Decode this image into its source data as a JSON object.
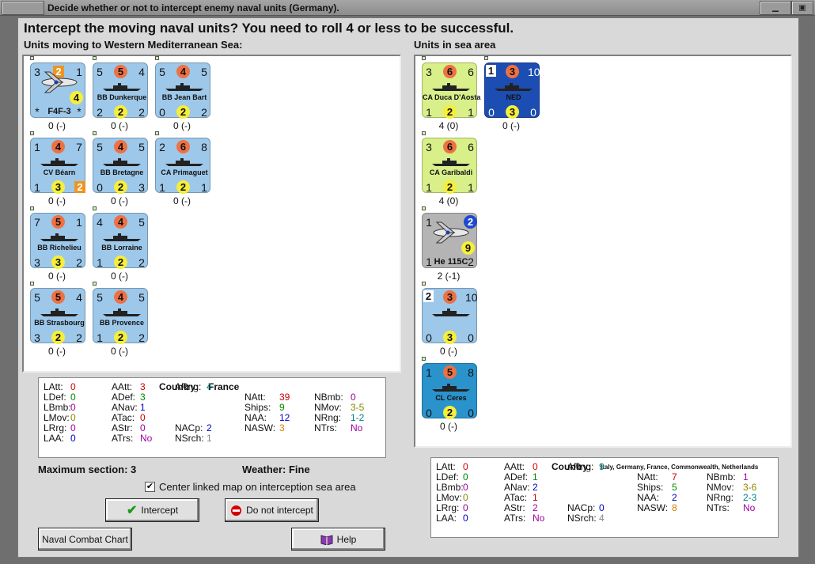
{
  "window": {
    "title": "Decide whether or not to intercept enemy naval units (Germany).",
    "min_glyph": "▁",
    "max_glyph": "▣"
  },
  "heading": "Intercept the moving naval units?  You need to roll 4 or less to be successful.",
  "left_label": "Units moving to Western Mediterranean Sea:",
  "right_label": "Units in sea area",
  "moving_units": [
    {
      "name": "F4F-3",
      "kind": "air",
      "tl": "3",
      "tc": "2",
      "tr": "1",
      "bl": "*",
      "bc": "4",
      "br": "*",
      "value": "0 (-)"
    },
    {
      "name": "BB Dunkerque",
      "tl": "5",
      "tc": "5",
      "tr": "4",
      "bl": "2",
      "bc": "2",
      "br": "2",
      "value": "0 (-)"
    },
    {
      "name": "BB Jean Bart",
      "tl": "5",
      "tc": "4",
      "tr": "5",
      "bl": "0",
      "bc": "2",
      "br": "2",
      "value": "0 (-)"
    },
    {
      "name": "CV Béarn",
      "tl": "1",
      "tc": "4",
      "tr": "7",
      "bl": "1",
      "bc": "3",
      "br": "2",
      "value": "0 (-)"
    },
    {
      "name": "BB Bretagne",
      "tl": "5",
      "tc": "4",
      "tr": "5",
      "bl": "0",
      "bc": "2",
      "br": "3",
      "value": "0 (-)"
    },
    {
      "name": "CA Primaguet",
      "tl": "2",
      "tc": "6",
      "tr": "8",
      "bl": "1",
      "bc": "2",
      "br": "1",
      "value": "0 (-)"
    },
    {
      "name": "BB Richelieu",
      "tl": "7",
      "tc": "5",
      "tr": "1",
      "bl": "3",
      "bc": "3",
      "br": "2",
      "value": "0 (-)"
    },
    {
      "name": "BB Lorraine",
      "tl": "4",
      "tc": "4",
      "tr": "5",
      "bl": "1",
      "bc": "2",
      "br": "2",
      "value": "0 (-)"
    },
    {
      "name": "BB Strasbourg",
      "tl": "5",
      "tc": "5",
      "tr": "4",
      "bl": "3",
      "bc": "2",
      "br": "2",
      "value": "0 (-)"
    },
    {
      "name": "BB Provence",
      "tl": "5",
      "tc": "4",
      "tr": "5",
      "bl": "1",
      "bc": "2",
      "br": "2",
      "value": "0 (-)"
    }
  ],
  "sea_units": [
    {
      "name": "CA Duca D'Aosta",
      "tl": "3",
      "tc": "6",
      "tr": "6",
      "bl": "1",
      "bc": "2",
      "br": "1",
      "value": "4 (0)"
    },
    {
      "name": "NED",
      "tl": "1",
      "tc": "3",
      "tr": "10",
      "bl": "0",
      "bc": "3",
      "br": "0",
      "value": "0 (-)"
    },
    {
      "name": "CA Garibaldi",
      "tl": "3",
      "tc": "6",
      "tr": "6",
      "bl": "1",
      "bc": "2",
      "br": "1",
      "value": "4 (0)"
    },
    {
      "name": "He 115C",
      "tl": "1",
      "tc": "",
      "tr": "2",
      "bl": "1",
      "bc": "9",
      "br": "2",
      "value": "2 (-1)"
    },
    {
      "name": "",
      "tl": "2",
      "tc": "3",
      "tr": "10",
      "bl": "0",
      "bc": "3",
      "br": "0",
      "value": "0 (-)"
    },
    {
      "name": "CL Ceres",
      "tl": "1",
      "tc": "5",
      "tr": "8",
      "bl": "0",
      "bc": "2",
      "br": "0",
      "value": "0 (-)"
    }
  ],
  "left_stats": {
    "country_label": "Country:",
    "country": "France",
    "col1": [
      [
        "LAtt:",
        "0"
      ],
      [
        "LDef:",
        "0"
      ],
      [
        "LBmb:",
        "0"
      ],
      [
        "LMov:",
        "0"
      ],
      [
        "LRrg:",
        "0"
      ],
      [
        "LAA:",
        "0"
      ]
    ],
    "col2": [
      [
        "AAtt:",
        "3"
      ],
      [
        "ADef:",
        "3"
      ],
      [
        "ANav:",
        "1"
      ],
      [
        "ATac:",
        "0"
      ],
      [
        "AStr:",
        "0"
      ],
      [
        "ATrs:",
        "No"
      ]
    ],
    "col3": [
      [
        "ARng:",
        "4"
      ],
      [
        "NACp:",
        "2"
      ],
      [
        "NSrch:",
        "1"
      ]
    ],
    "col4": [
      [
        "NAtt:",
        "39"
      ],
      [
        "Ships:",
        "9"
      ],
      [
        "NAA:",
        "12"
      ],
      [
        "NASW:",
        "3"
      ]
    ],
    "col5": [
      [
        "NBmb:",
        "0"
      ],
      [
        "NMov:",
        "3-5"
      ],
      [
        "NRng:",
        "1-2"
      ],
      [
        "NTrs:",
        "No"
      ]
    ]
  },
  "right_stats": {
    "country_label": "Country:",
    "country": "Italy, Germany, France, Commonwealth, Netherlands",
    "col1": [
      [
        "LAtt:",
        "0"
      ],
      [
        "LDef:",
        "0"
      ],
      [
        "LBmb:",
        "0"
      ],
      [
        "LMov:",
        "0"
      ],
      [
        "LRrg:",
        "0"
      ],
      [
        "LAA:",
        "0"
      ]
    ],
    "col2": [
      [
        "AAtt:",
        "0"
      ],
      [
        "ADef:",
        "1"
      ],
      [
        "ANav:",
        "2"
      ],
      [
        "ATac:",
        "1"
      ],
      [
        "AStr:",
        "2"
      ],
      [
        "ATrs:",
        "No"
      ]
    ],
    "col3": [
      [
        "ARng:",
        "9"
      ],
      [
        "NACp:",
        "0"
      ],
      [
        "NSrch:",
        "4"
      ]
    ],
    "col4": [
      [
        "NAtt:",
        "7"
      ],
      [
        "Ships:",
        "5"
      ],
      [
        "NAA:",
        "2"
      ],
      [
        "NASW:",
        "8"
      ]
    ],
    "col5": [
      [
        "NBmb:",
        "1"
      ],
      [
        "NMov:",
        "3-6"
      ],
      [
        "NRng:",
        "2-3"
      ],
      [
        "NTrs:",
        "No"
      ]
    ]
  },
  "bottom": {
    "max_section": "Maximum section: 3",
    "weather": "Weather:  Fine",
    "center_map": "Center linked map on interception sea area",
    "center_checked": true,
    "intercept": "Intercept",
    "no_intercept": "Do not intercept",
    "chart": "Naval Combat Chart",
    "help": "Help"
  }
}
